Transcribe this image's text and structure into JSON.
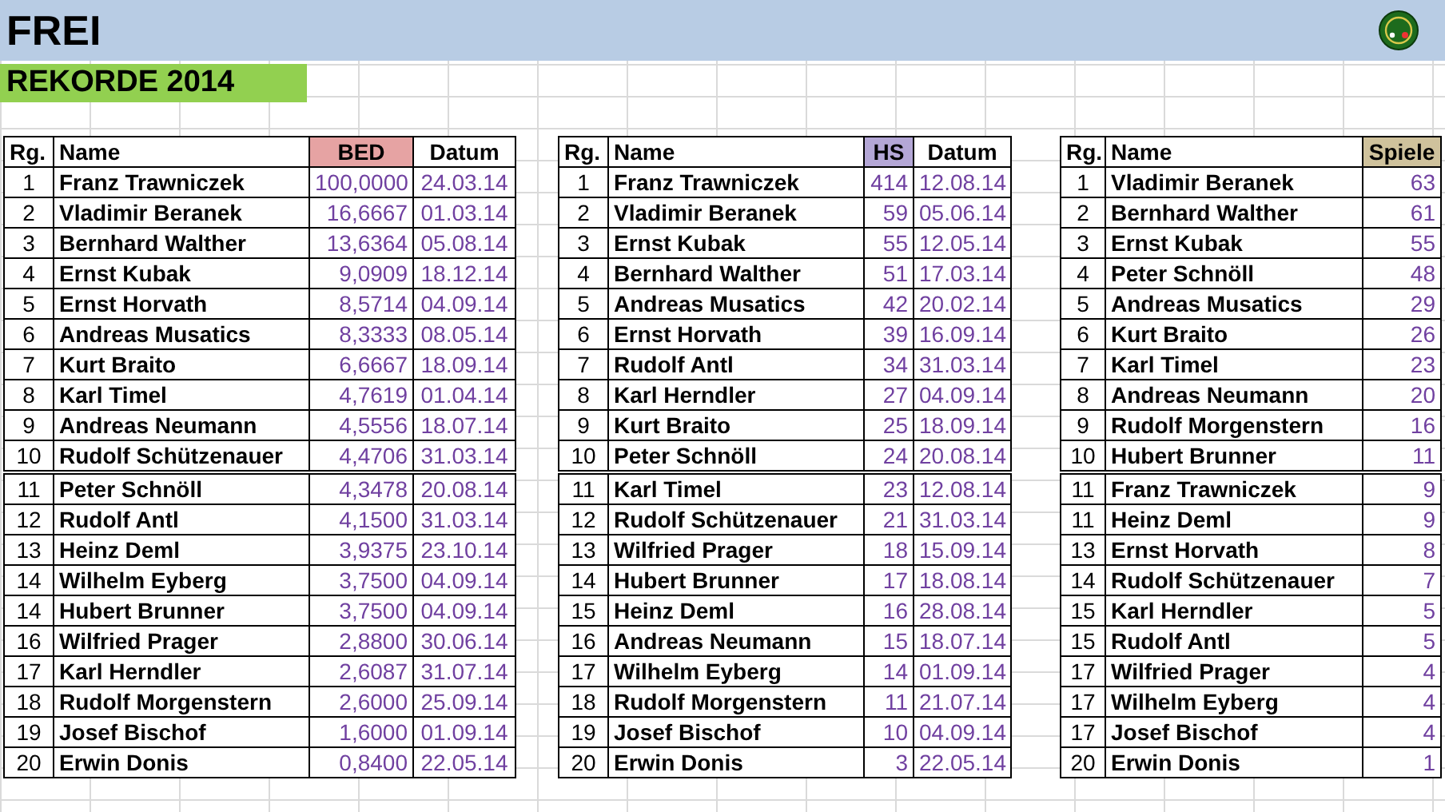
{
  "title": "FREI",
  "subtitle": "REKORDE 2014",
  "tables": [
    {
      "columns": [
        {
          "label": "Rg.",
          "kind": "rank"
        },
        {
          "label": "Name",
          "kind": "name"
        },
        {
          "label": "BED",
          "kind": "value",
          "color": "#e6a3a3"
        },
        {
          "label": "Datum",
          "kind": "date"
        }
      ],
      "groups": [
        [
          [
            "1",
            "Franz Trawniczek",
            "100,0000",
            "24.03.14"
          ],
          [
            "2",
            "Vladimir Beranek",
            "16,6667",
            "01.03.14"
          ],
          [
            "3",
            "Bernhard Walther",
            "13,6364",
            "05.08.14"
          ],
          [
            "4",
            "Ernst Kubak",
            "9,0909",
            "18.12.14"
          ],
          [
            "5",
            "Ernst Horvath",
            "8,5714",
            "04.09.14"
          ],
          [
            "6",
            "Andreas Musatics",
            "8,3333",
            "08.05.14"
          ],
          [
            "7",
            "Kurt Braito",
            "6,6667",
            "18.09.14"
          ],
          [
            "8",
            "Karl Timel",
            "4,7619",
            "01.04.14"
          ],
          [
            "9",
            "Andreas Neumann",
            "4,5556",
            "18.07.14"
          ],
          [
            "10",
            "Rudolf Schützenauer",
            "4,4706",
            "31.03.14"
          ]
        ],
        [
          [
            "11",
            "Peter Schnöll",
            "4,3478",
            "20.08.14"
          ],
          [
            "12",
            "Rudolf Antl",
            "4,1500",
            "31.03.14"
          ],
          [
            "13",
            "Heinz Deml",
            "3,9375",
            "23.10.14"
          ],
          [
            "14",
            "Wilhelm Eyberg",
            "3,7500",
            "04.09.14"
          ],
          [
            "14",
            "Hubert Brunner",
            "3,7500",
            "04.09.14"
          ],
          [
            "16",
            "Wilfried Prager",
            "2,8800",
            "30.06.14"
          ],
          [
            "17",
            "Karl Herndler",
            "2,6087",
            "31.07.14"
          ],
          [
            "18",
            "Rudolf Morgenstern",
            "2,6000",
            "25.09.14"
          ],
          [
            "19",
            "Josef Bischof",
            "1,6000",
            "01.09.14"
          ],
          [
            "20",
            "Erwin Donis",
            "0,8400",
            "22.05.14"
          ]
        ]
      ]
    },
    {
      "columns": [
        {
          "label": "Rg.",
          "kind": "rank"
        },
        {
          "label": "Name",
          "kind": "name"
        },
        {
          "label": "HS",
          "kind": "value",
          "color": "#b4a7d6"
        },
        {
          "label": "Datum",
          "kind": "date"
        }
      ],
      "groups": [
        [
          [
            "1",
            "Franz Trawniczek",
            "414",
            "12.08.14"
          ],
          [
            "2",
            "Vladimir Beranek",
            "59",
            "05.06.14"
          ],
          [
            "3",
            "Ernst Kubak",
            "55",
            "12.05.14"
          ],
          [
            "4",
            "Bernhard Walther",
            "51",
            "17.03.14"
          ],
          [
            "5",
            "Andreas Musatics",
            "42",
            "20.02.14"
          ],
          [
            "6",
            "Ernst Horvath",
            "39",
            "16.09.14"
          ],
          [
            "7",
            "Rudolf Antl",
            "34",
            "31.03.14"
          ],
          [
            "8",
            "Karl Herndler",
            "27",
            "04.09.14"
          ],
          [
            "9",
            "Kurt Braito",
            "25",
            "18.09.14"
          ],
          [
            "10",
            "Peter Schnöll",
            "24",
            "20.08.14"
          ]
        ],
        [
          [
            "11",
            "Karl Timel",
            "23",
            "12.08.14"
          ],
          [
            "12",
            "Rudolf Schützenauer",
            "21",
            "31.03.14"
          ],
          [
            "13",
            "Wilfried Prager",
            "18",
            "15.09.14"
          ],
          [
            "14",
            "Hubert Brunner",
            "17",
            "18.08.14"
          ],
          [
            "15",
            "Heinz Deml",
            "16",
            "28.08.14"
          ],
          [
            "16",
            "Andreas Neumann",
            "15",
            "18.07.14"
          ],
          [
            "17",
            "Wilhelm Eyberg",
            "14",
            "01.09.14"
          ],
          [
            "18",
            "Rudolf Morgenstern",
            "11",
            "21.07.14"
          ],
          [
            "19",
            "Josef Bischof",
            "10",
            "04.09.14"
          ],
          [
            "20",
            "Erwin Donis",
            "3",
            "22.05.14"
          ]
        ]
      ]
    },
    {
      "columns": [
        {
          "label": "Rg.",
          "kind": "rank"
        },
        {
          "label": "Name",
          "kind": "name"
        },
        {
          "label": "Spiele",
          "kind": "value",
          "color": "#cfc29c"
        }
      ],
      "groups": [
        [
          [
            "1",
            "Vladimir Beranek",
            "63"
          ],
          [
            "2",
            "Bernhard Walther",
            "61"
          ],
          [
            "3",
            "Ernst Kubak",
            "55"
          ],
          [
            "4",
            "Peter Schnöll",
            "48"
          ],
          [
            "5",
            "Andreas Musatics",
            "29"
          ],
          [
            "6",
            "Kurt Braito",
            "26"
          ],
          [
            "7",
            "Karl Timel",
            "23"
          ],
          [
            "8",
            "Andreas Neumann",
            "20"
          ],
          [
            "9",
            "Rudolf Morgenstern",
            "16"
          ],
          [
            "10",
            "Hubert Brunner",
            "11"
          ]
        ],
        [
          [
            "11",
            "Franz Trawniczek",
            "9"
          ],
          [
            "11",
            "Heinz Deml",
            "9"
          ],
          [
            "13",
            "Ernst Horvath",
            "8"
          ],
          [
            "14",
            "Rudolf Schützenauer",
            "7"
          ],
          [
            "15",
            "Karl Herndler",
            "5"
          ],
          [
            "15",
            "Rudolf Antl",
            "5"
          ],
          [
            "17",
            "Wilfried Prager",
            "4"
          ],
          [
            "17",
            "Wilhelm Eyberg",
            "4"
          ],
          [
            "17",
            "Josef Bischof",
            "4"
          ],
          [
            "20",
            "Erwin Donis",
            "1"
          ]
        ]
      ]
    }
  ]
}
